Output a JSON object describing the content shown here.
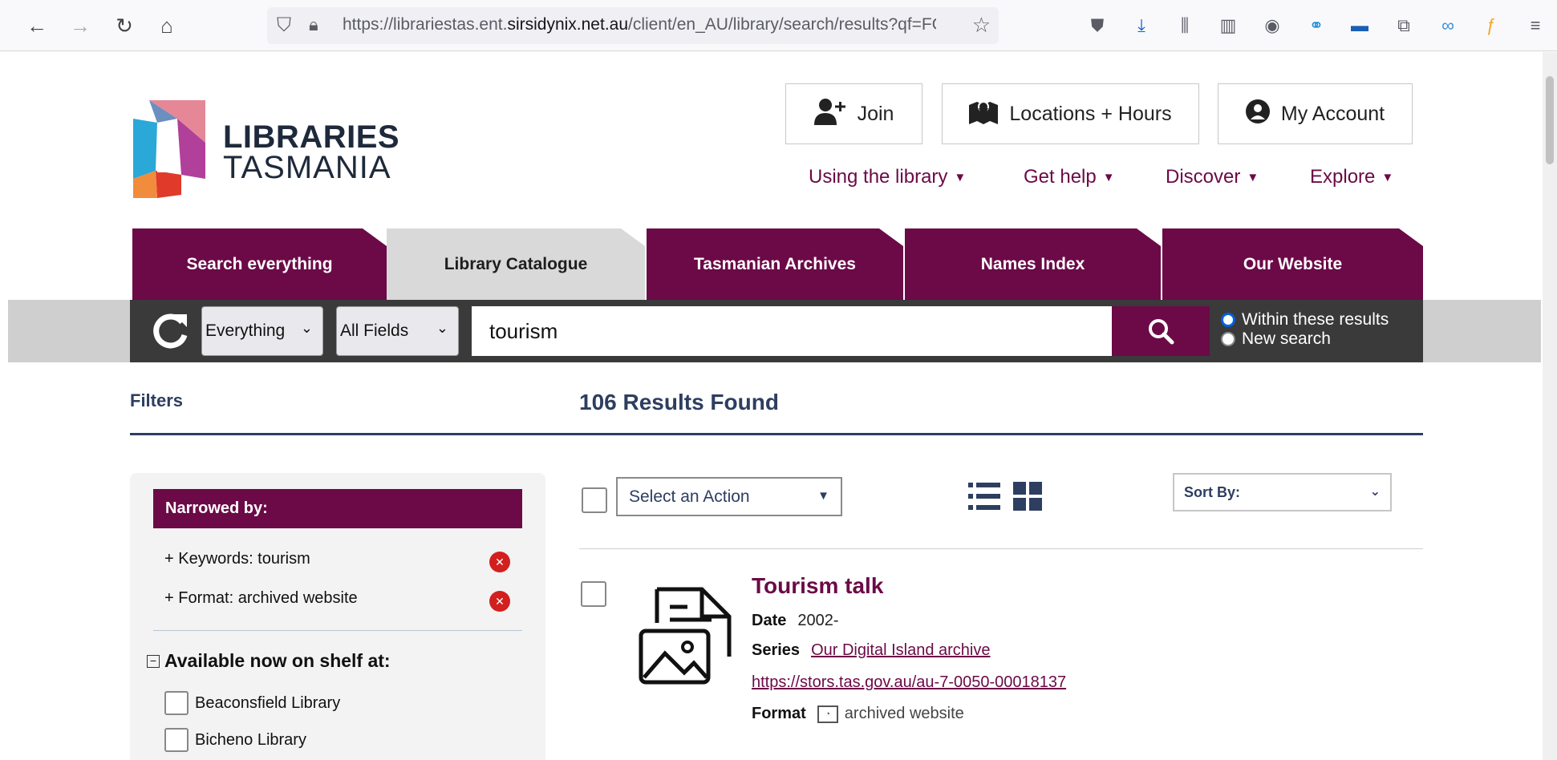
{
  "browser": {
    "url_prefix": "https://librariestas.ent.",
    "url_domain": "sirsidynix.net.au",
    "url_suffix": "/client/en_AU/library/search/results?qf=FORM"
  },
  "header": {
    "logo_line1": "LIBRARIES",
    "logo_line2": "TASMANIA",
    "join": "Join",
    "locations": "Locations + Hours",
    "account": "My Account",
    "nav": [
      "Using the library",
      "Get help",
      "Discover",
      "Explore"
    ]
  },
  "tabs": [
    "Search everything",
    "Library Catalogue",
    "Tasmanian Archives",
    "Names Index",
    "Our Website"
  ],
  "search": {
    "scope": "Everything",
    "field": "All Fields",
    "query": "tourism",
    "radio_within": "Within these results",
    "radio_new": "New search"
  },
  "filters": {
    "title": "Filters",
    "narrowed_by": "Narrowed by:",
    "narrowed_items": [
      "Keywords: tourism",
      "Format: archived website"
    ],
    "available_heading": "Available now on shelf at:",
    "libraries": [
      "Beaconsfield Library",
      "Bicheno Library"
    ]
  },
  "results": {
    "count_text": "106 Results Found",
    "action_placeholder": "Select an Action",
    "sort_label": "Sort By:",
    "items": [
      {
        "title": "Tourism talk",
        "date_label": "Date",
        "date": "2002-",
        "series_label": "Series",
        "series": "Our Digital Island archive",
        "link": "https://stors.tas.gov.au/au-7-0050-00018137",
        "format_label": "Format",
        "format": "archived website"
      }
    ]
  },
  "colors": {
    "brand": "#6b0a47",
    "navy": "#2d3e60",
    "remove": "#d2201e"
  }
}
